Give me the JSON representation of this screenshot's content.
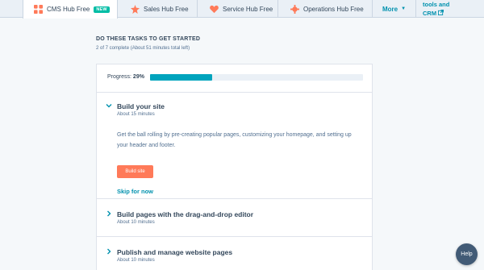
{
  "tabs": [
    {
      "label": "CMS Hub Free",
      "badge": "NEW",
      "icon": "cms-hub-icon",
      "color": "#ff7a59"
    },
    {
      "label": "Sales Hub Free",
      "icon": "sales-hub-icon",
      "color": "#ff7a59"
    },
    {
      "label": "Service Hub Free",
      "icon": "service-hub-icon",
      "color": "#ff7a59"
    },
    {
      "label": "Operations Hub Free",
      "icon": "operations-hub-icon",
      "color": "#ff7a59"
    }
  ],
  "more_label": "More",
  "tools": {
    "line1": "tools and",
    "line2": "CRM"
  },
  "header": {
    "title": "DO THESE TASKS TO GET STARTED",
    "subtitle": "2 of 7 complete (About 51 minutes total left)"
  },
  "progress": {
    "label": "Progress:",
    "value_text": "29%",
    "value": 0.29
  },
  "tasks": [
    {
      "title": "Build your site",
      "time": "About 15 minutes",
      "expanded": true,
      "description": "Get the ball rolling by pre-creating popular pages, customizing your homepage, and setting up your header and footer.",
      "button": "Build site",
      "skip": "Skip for now"
    },
    {
      "title": "Build pages with the drag-and-drop editor",
      "time": "About 10 minutes",
      "expanded": false
    },
    {
      "title": "Publish and manage website pages",
      "time": "About 10 minutes",
      "expanded": false
    }
  ],
  "help_label": "Help",
  "colors": {
    "accent": "#0091ae",
    "progress": "#00a4bd",
    "button": "#ff7a59",
    "badge": "#00bda5"
  }
}
